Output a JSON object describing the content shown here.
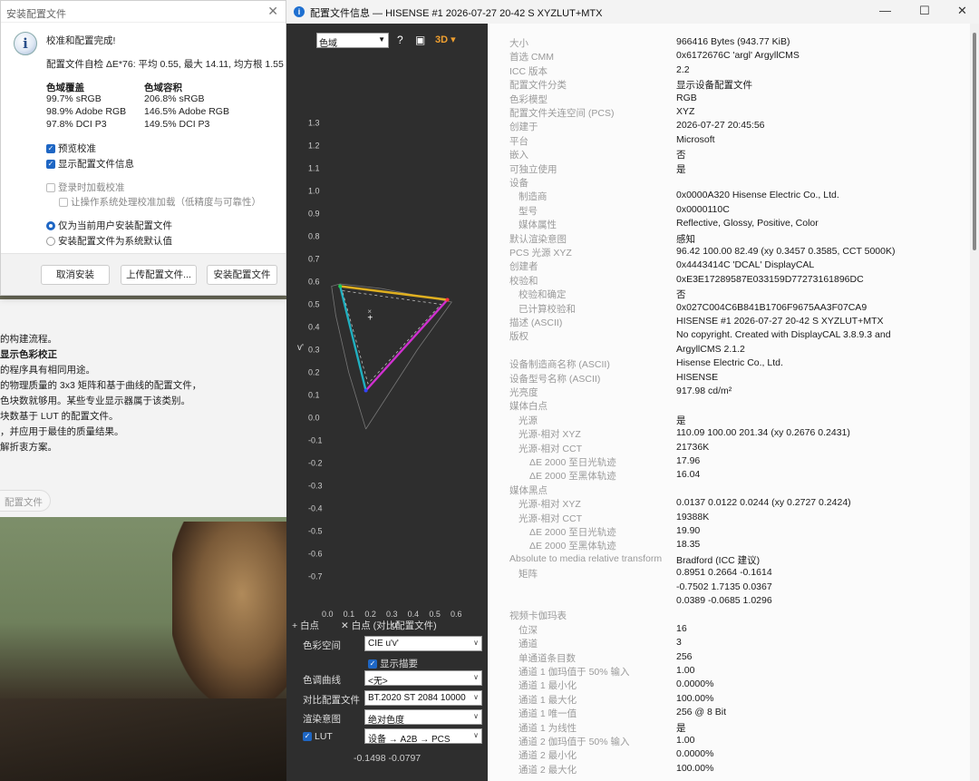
{
  "installer": {
    "title": "安装配置文件",
    "heading": "校准和配置完成!",
    "selfcheck": "配置文件自检 ΔE*76: 平均 0.55, 最大 14.11, 均方根 1.55",
    "coverage_label": "色域覆盖",
    "volume_label": "色域容积",
    "coverage": [
      "99.7% sRGB",
      "98.9% Adobe RGB",
      "97.8% DCI P3"
    ],
    "volume": [
      "206.8% sRGB",
      "146.5% Adobe RGB",
      "149.5% DCI P3"
    ],
    "preview_calibration": "预览校准",
    "show_profile_info": "显示配置文件信息",
    "load_on_login": "登录时加载校准",
    "let_os_handle": "让操作系统处理校准加载（低精度与可靠性）",
    "install_current_user": "仅为当前用户安装配置文件",
    "install_system_default": "安装配置文件为系统默认值",
    "cancel": "取消安装",
    "upload": "上传配置文件...",
    "install": "安装配置文件"
  },
  "background_doc": {
    "lines": [
      "的构建流程。",
      "显示色彩校正",
      "的程序具有相同用途。",
      "的物理质量的 3x3 矩阵和基于曲线的配置文件，",
      "色块数就够用。某些专业显示器属于该类别。",
      "块数基于 LUT 的配置文件。",
      "，并应用于最佳的质量结果。",
      "解折衷方案。"
    ],
    "button": "配置文件"
  },
  "info_window": {
    "title": "配置文件信息 — HISENSE #1 2026-07-27 20-42 S XYZLUT+MTX",
    "minimize": "—",
    "maximize": "☐",
    "close": "✕"
  },
  "chart_panel": {
    "view_select": "色域",
    "help_icon": "?",
    "image_icon": "▣",
    "mode_label": "3D",
    "legend_white": "白点",
    "legend_white_compare": "白点 (对比配置文件)",
    "colorspace_label": "色彩空间",
    "colorspace_value": "CIE u'v'",
    "show_outline": "显示描要",
    "tone_curve_label": "色调曲线",
    "tone_curve_value": "<无>",
    "compare_label": "对比配置文件",
    "compare_value": "BT.2020 ST 2084 10000",
    "intent_label": "渲染意图",
    "intent_value": "绝对色度",
    "lut_label": "LUT",
    "lut_value": "设备 → A2B → PCS",
    "readout": "-0.1498 -0.0797"
  },
  "chart_data": {
    "type": "scatter",
    "xlabel": "u'",
    "ylabel": "v'",
    "xlim": [
      0.0,
      0.6
    ],
    "ylim": [
      -0.75,
      1.35
    ],
    "x_ticks": [
      "0.0",
      "0.1",
      "0.2",
      "0.3",
      "0.4",
      "0.5",
      "0.6"
    ],
    "y_ticks": [
      "1.3",
      "1.2",
      "1.1",
      "1.0",
      "0.9",
      "0.8",
      "0.7",
      "0.6",
      "0.5",
      "0.4",
      "0.3",
      "0.2",
      "0.1",
      "0.0",
      "-0.1",
      "-0.2",
      "-0.3",
      "-0.4",
      "-0.5",
      "-0.6",
      "-0.7"
    ],
    "gamut_triangle": [
      {
        "name": "green",
        "u": 0.06,
        "v": 0.58,
        "color": "#22cc55"
      },
      {
        "name": "red",
        "u": 0.56,
        "v": 0.52,
        "color": "#ff3344"
      },
      {
        "name": "blue",
        "u": 0.18,
        "v": 0.12,
        "color": "#3344ff"
      }
    ],
    "white_point": {
      "u": 0.2,
      "v": 0.44
    },
    "white_point_compare": {
      "u": 0.2,
      "v": 0.47
    }
  },
  "info_rows": [
    {
      "k": "大小",
      "v": "966416 Bytes (943.77 KiB)",
      "indent": 0
    },
    {
      "k": "首选 CMM",
      "v": "0x6172676C 'argl' ArgyllCMS",
      "indent": 0
    },
    {
      "k": "ICC 版本",
      "v": "2.2",
      "indent": 0
    },
    {
      "k": "配置文件分类",
      "v": "显示设备配置文件",
      "indent": 0
    },
    {
      "k": "色彩模型",
      "v": "RGB",
      "indent": 0
    },
    {
      "k": "配置文件关连空间 (PCS)",
      "v": "XYZ",
      "indent": 0
    },
    {
      "k": "创建于",
      "v": "2026-07-27 20:45:56",
      "indent": 0
    },
    {
      "k": "平台",
      "v": "Microsoft",
      "indent": 0
    },
    {
      "k": "嵌入",
      "v": "否",
      "indent": 0
    },
    {
      "k": "可独立使用",
      "v": "是",
      "indent": 0
    },
    {
      "k": "设备",
      "v": "",
      "indent": 0
    },
    {
      "k": "制造商",
      "v": "0x0000A320 Hisense Electric Co., Ltd.",
      "indent": 1
    },
    {
      "k": "型号",
      "v": "0x0000110C",
      "indent": 1
    },
    {
      "k": "媒体属性",
      "v": "Reflective, Glossy, Positive, Color",
      "indent": 1
    },
    {
      "k": "默认渲染意图",
      "v": "感知",
      "indent": 0
    },
    {
      "k": "PCS 光源 XYZ",
      "v": "96.42 100.00  82.49 (xy 0.3457 0.3585, CCT 5000K)",
      "indent": 0
    },
    {
      "k": "创建者",
      "v": "0x4443414C 'DCAL' DisplayCAL",
      "indent": 0
    },
    {
      "k": "校验和",
      "v": "0xE3E17289587E033159D77273161896DC",
      "indent": 0
    },
    {
      "k": "校验和确定",
      "v": "否",
      "indent": 1
    },
    {
      "k": "已计算校验和",
      "v": "0x027C004C6B841B1706F9675AA3F07CA9",
      "indent": 1
    },
    {
      "k": "描述 (ASCII)",
      "v": "HISENSE #1 2026-07-27 20-42 S XYZLUT+MTX",
      "indent": 0
    },
    {
      "k": "版权",
      "v": "No copyright. Created with DisplayCAL 3.8.9.3 and",
      "indent": 0
    },
    {
      "k": "",
      "v": "ArgyllCMS 2.1.2",
      "indent": 0
    },
    {
      "k": "设备制造商名称 (ASCII)",
      "v": "Hisense Electric Co., Ltd.",
      "indent": 0
    },
    {
      "k": "设备型号名称 (ASCII)",
      "v": "HISENSE",
      "indent": 0
    },
    {
      "k": "光亮度",
      "v": "917.98 cd/m²",
      "indent": 0
    },
    {
      "k": "媒体白点",
      "v": "",
      "indent": 0
    },
    {
      "k": "光源",
      "v": "是",
      "indent": 1
    },
    {
      "k": "光源-相对 XYZ",
      "v": "110.09 100.00 201.34 (xy 0.2676 0.2431)",
      "indent": 1
    },
    {
      "k": "光源-相对 CCT",
      "v": "21736K",
      "indent": 1
    },
    {
      "k": "ΔE 2000 至日光轨迹",
      "v": "17.96",
      "indent": 2
    },
    {
      "k": "ΔE 2000 至黑体轨迹",
      "v": "16.04",
      "indent": 2
    },
    {
      "k": "媒体黑点",
      "v": "",
      "indent": 0
    },
    {
      "k": "光源-相对 XYZ",
      "v": "0.0137 0.0122 0.0244 (xy 0.2727 0.2424)",
      "indent": 1
    },
    {
      "k": "光源-相对 CCT",
      "v": "19388K",
      "indent": 1
    },
    {
      "k": "ΔE 2000 至日光轨迹",
      "v": "19.90",
      "indent": 2
    },
    {
      "k": "ΔE 2000 至黑体轨迹",
      "v": "18.35",
      "indent": 2
    },
    {
      "k": "Absolute to media relative transform",
      "v": "Bradford (ICC 建议)",
      "indent": 0
    },
    {
      "k": "矩阵",
      "v": "0.8951 0.2664 -0.1614",
      "indent": 1
    },
    {
      "k": "",
      "v": "-0.7502 1.7135 0.0367",
      "indent": 0
    },
    {
      "k": "",
      "v": "0.0389 -0.0685 1.0296",
      "indent": 0
    },
    {
      "k": "视频卡伽玛表",
      "v": "",
      "indent": 0
    },
    {
      "k": "位深",
      "v": "16",
      "indent": 1
    },
    {
      "k": "通道",
      "v": "3",
      "indent": 1
    },
    {
      "k": "单通道条目数",
      "v": "256",
      "indent": 1
    },
    {
      "k": "通道 1 伽玛值于 50% 输入",
      "v": "1.00",
      "indent": 1
    },
    {
      "k": "通道 1 最小化",
      "v": "0.0000%",
      "indent": 1
    },
    {
      "k": "通道 1 最大化",
      "v": "100.00%",
      "indent": 1
    },
    {
      "k": "通道 1 唯一值",
      "v": "256 @ 8 Bit",
      "indent": 1
    },
    {
      "k": "通道 1 为线性",
      "v": "是",
      "indent": 1
    },
    {
      "k": "通道 2 伽玛值于 50% 输入",
      "v": "1.00",
      "indent": 1
    },
    {
      "k": "通道 2 最小化",
      "v": "0.0000%",
      "indent": 1
    },
    {
      "k": "通道 2 最大化",
      "v": "100.00%",
      "indent": 1
    }
  ]
}
